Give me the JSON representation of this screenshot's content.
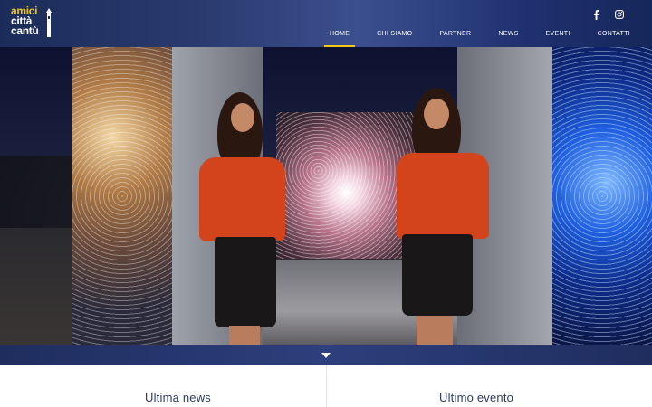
{
  "header": {
    "logo": {
      "line1": "amici",
      "line2": "città",
      "line3": "cantù"
    },
    "social": [
      {
        "icon": "facebook-icon",
        "glyph": "f"
      },
      {
        "icon": "instagram-icon",
        "glyph": "◎"
      }
    ],
    "nav": [
      {
        "label": "HOME",
        "active": true
      },
      {
        "label": "CHI SIAMO",
        "active": false
      },
      {
        "label": "PARTNER",
        "active": false
      },
      {
        "label": "NEWS",
        "active": false
      },
      {
        "label": "EVENTI",
        "active": false
      },
      {
        "label": "CONTATTI",
        "active": false
      }
    ]
  },
  "hero": {
    "scroll_icon": "chevron-down-icon"
  },
  "sections": {
    "left_title": "Ultima news",
    "right_title": "Ultimo evento"
  },
  "colors": {
    "accent": "#f5c518",
    "header_bg": "#1b2c5a",
    "title_text": "#2c3c63"
  }
}
